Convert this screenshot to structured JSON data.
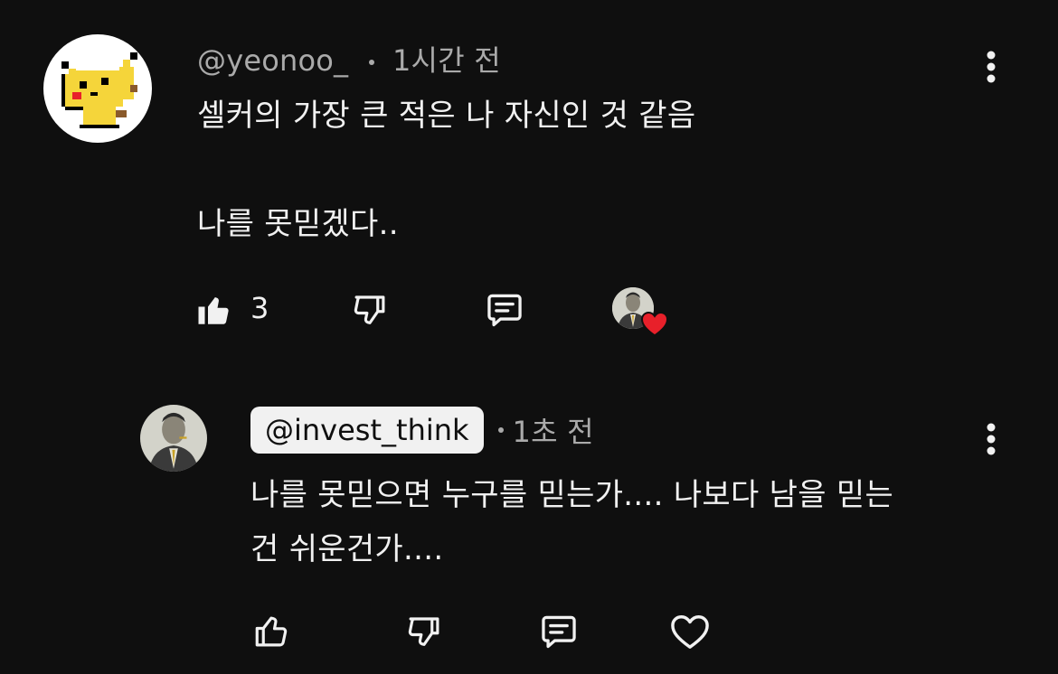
{
  "comment": {
    "author": "@yeonoo_",
    "time": "1시간 전",
    "line1": "셀커의 가장 큰 적은 나 자신인 것 같음",
    "line2": "나를 못믿겠다..",
    "like_count": "3",
    "avatar_icon": "pikachu-pixel-avatar"
  },
  "reply": {
    "author": "@invest_think",
    "time": "1초 전",
    "line1": "나를 못믿으면 누구를 믿는가.... 나보다 남을 믿는",
    "line2": "건 쉬운건가....",
    "avatar_icon": "man-in-suit-avatar"
  },
  "icons": {
    "like": "thumbs-up-icon",
    "dislike": "thumbs-down-icon",
    "reply": "comment-icon",
    "heart": "heart-icon",
    "more": "more-vertical-icon"
  },
  "colors": {
    "background": "#0f0f0f",
    "text": "#f1f1f1",
    "meta": "#aaaaaa",
    "heart": "#e8202a",
    "pikachu": "#f5d53a"
  }
}
